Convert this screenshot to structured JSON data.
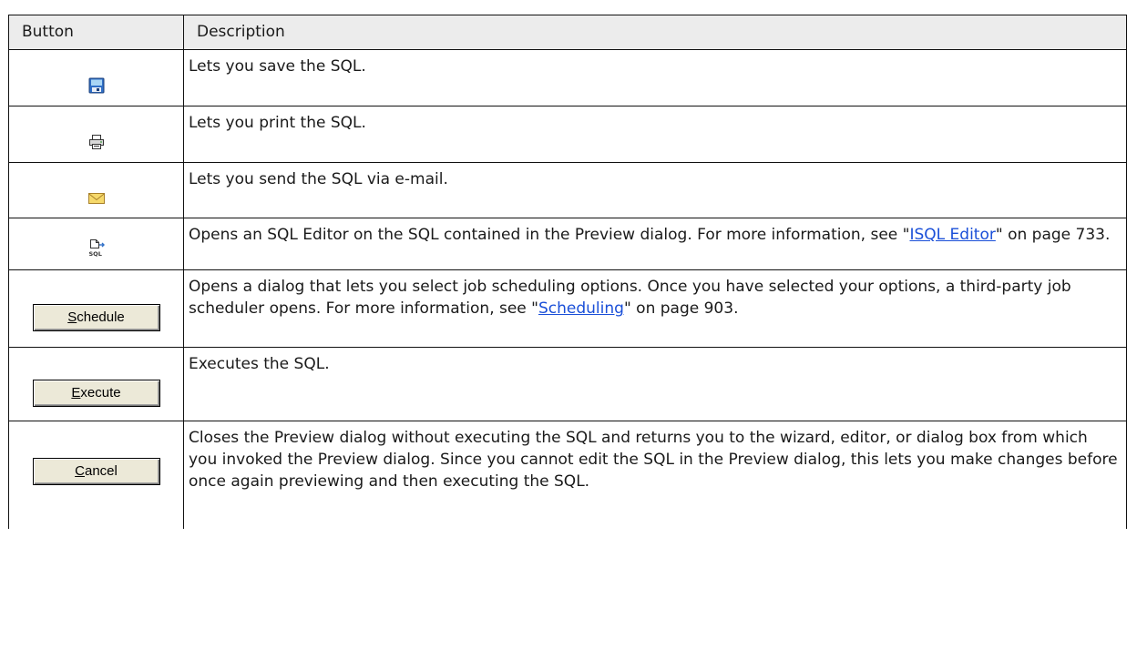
{
  "table": {
    "headers": {
      "button": "Button",
      "description": "Description"
    },
    "rows": [
      {
        "icon": "save-icon",
        "description": "Lets you save the SQL."
      },
      {
        "icon": "print-icon",
        "description": "Lets you print the SQL."
      },
      {
        "icon": "email-icon",
        "description": "Lets you send the SQL via e-mail."
      },
      {
        "icon": "open-sql-editor-icon",
        "desc_a": "Opens an SQL Editor on the SQL contained in the Preview dialog. For more information, see \"",
        "link": "ISQL Editor",
        "desc_b": "\" on page 733."
      },
      {
        "button_mnemonic": "S",
        "button_rest": "chedule",
        "desc_a": "Opens a dialog that lets you select job scheduling options. Once you have selected your options, a third-party job scheduler opens. For more information, see \"",
        "link": "Scheduling",
        "desc_b": "\" on page 903."
      },
      {
        "button_mnemonic": "E",
        "button_rest": "xecute",
        "description": "Executes the SQL."
      },
      {
        "button_mnemonic": "C",
        "button_rest": "ancel",
        "description": "Closes the Preview dialog without executing the SQL and returns you to the wizard, editor, or dialog box from which you invoked the Preview dialog. Since you cannot edit the SQL in the Preview dialog, this lets you make changes before once again previewing and then executing the SQL."
      }
    ]
  },
  "colors": {
    "link": "#1a4fd8",
    "header_bg": "#ececec",
    "button_face": "#ece9d8"
  }
}
